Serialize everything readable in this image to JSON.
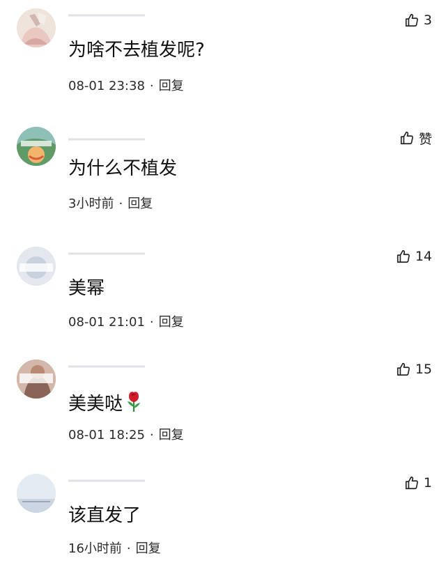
{
  "comments": [
    {
      "text": "为啥不去植发呢?",
      "time": "08-01 23:38",
      "reply_label": "回复",
      "like_label": "3"
    },
    {
      "text": "为什么不植发",
      "time": "3小时前",
      "reply_label": "回复",
      "like_label": "赞"
    },
    {
      "text": "美幂",
      "time": "08-01 21:01",
      "reply_label": "回复",
      "like_label": "14"
    },
    {
      "text": "美美哒",
      "time": "08-01 18:25",
      "reply_label": "回复",
      "like_label": "15"
    },
    {
      "text": "该直发了",
      "time": "16小时前",
      "reply_label": "回复",
      "like_label": "1"
    }
  ],
  "separator": "·",
  "icons": {
    "like": "thumbs-up-outline-icon",
    "emoji": "rose-emoji-icon"
  }
}
